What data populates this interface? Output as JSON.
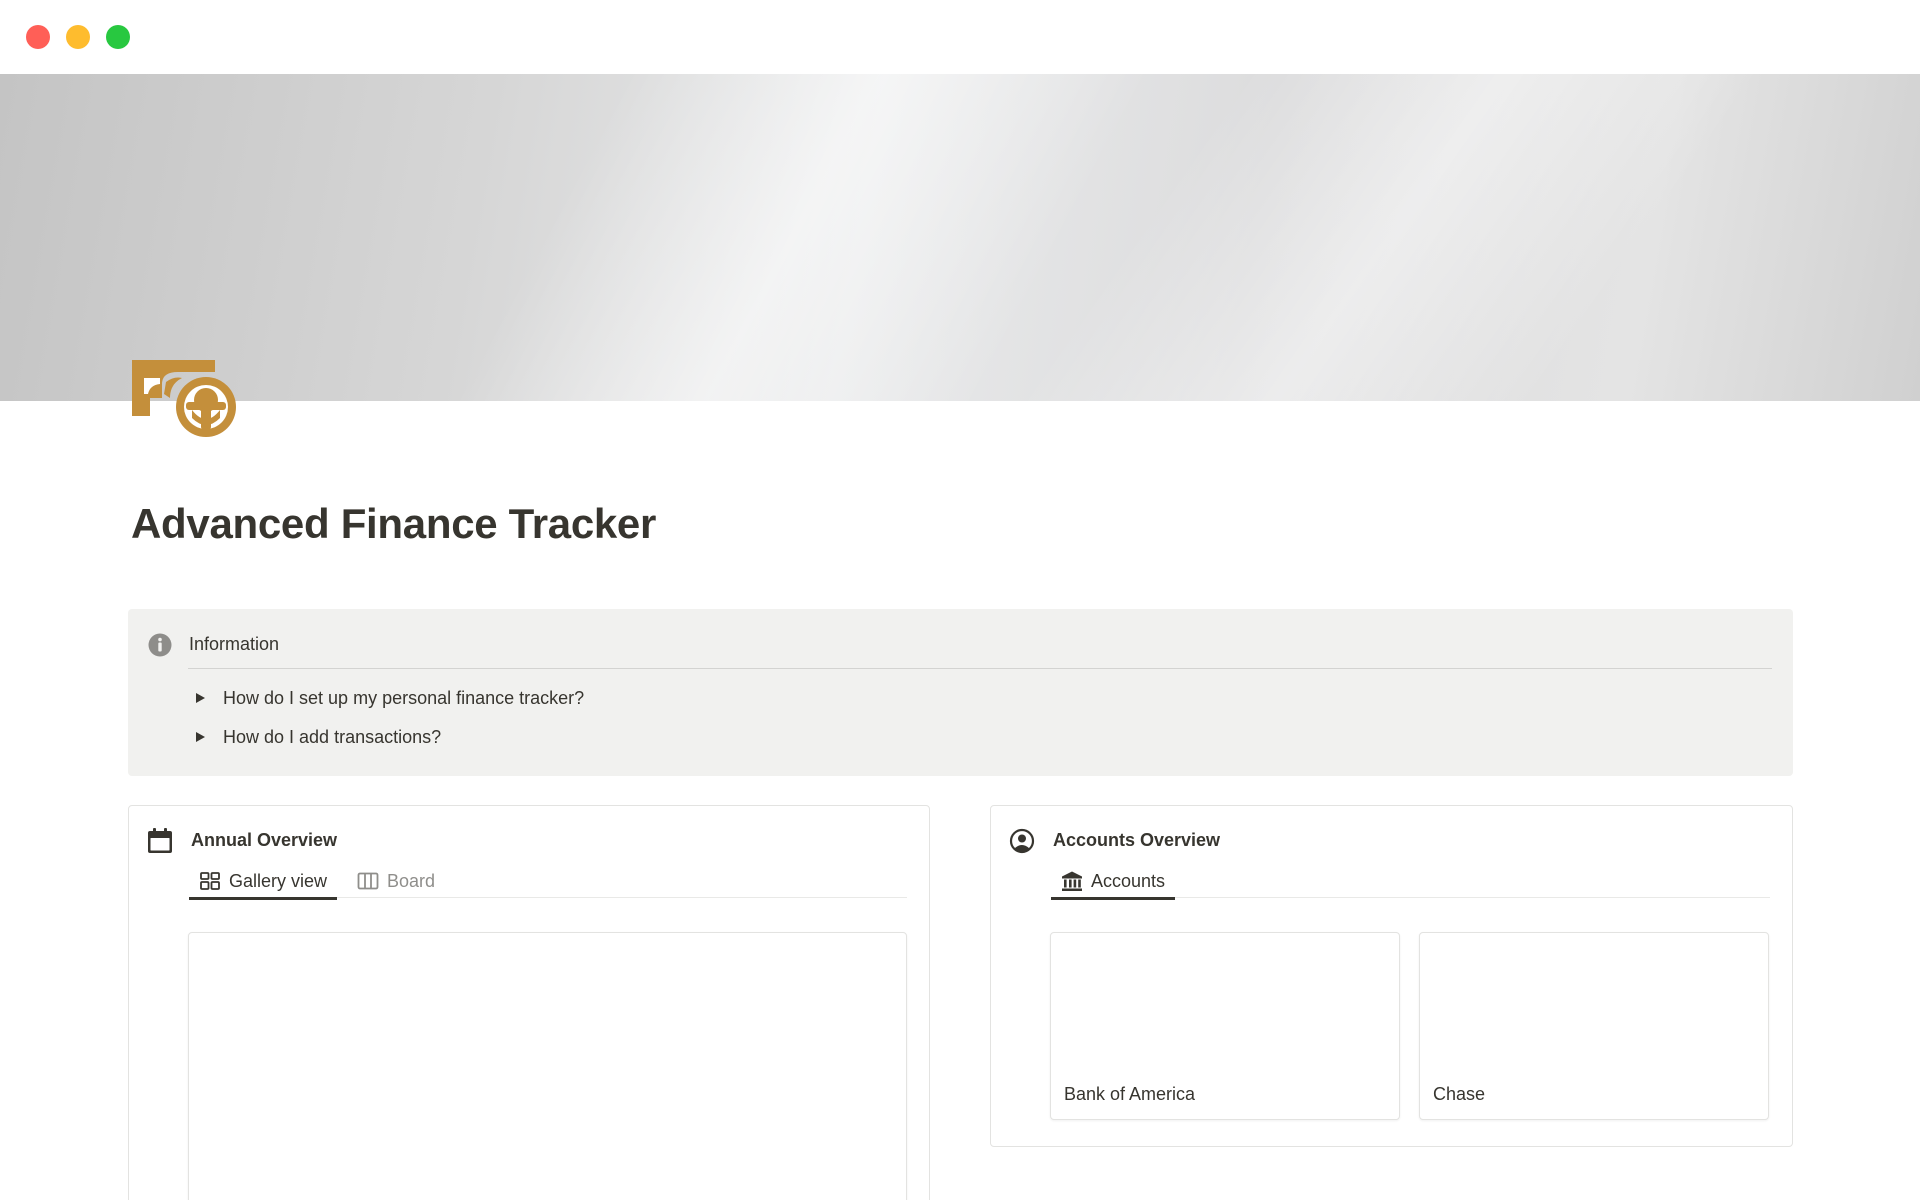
{
  "window": {
    "buttons": [
      "close",
      "minimize",
      "zoom"
    ],
    "colors": {
      "close": "#ff5f57",
      "minimize": "#febc2e",
      "zoom": "#28c840"
    }
  },
  "page": {
    "icon": "money-icon",
    "icon_color": "#c48f3b",
    "title": "Advanced Finance Tracker"
  },
  "callout": {
    "icon": "info-icon",
    "title": "Information",
    "toggles": [
      {
        "label": "How do I set up my personal finance tracker?"
      },
      {
        "label": "How do I add transactions?"
      }
    ]
  },
  "annual_overview": {
    "icon": "calendar-icon",
    "title": "Annual Overview",
    "tabs": [
      {
        "label": "Gallery view",
        "icon": "gallery-icon",
        "active": true
      },
      {
        "label": "Board",
        "icon": "board-icon",
        "active": false
      }
    ],
    "cards": [
      {
        "label": ""
      }
    ]
  },
  "accounts_overview": {
    "icon": "user-circle-icon",
    "title": "Accounts Overview",
    "tabs": [
      {
        "label": "Accounts",
        "icon": "bank-icon",
        "active": true
      }
    ],
    "cards": [
      {
        "label": "Bank of America"
      },
      {
        "label": "Chase"
      }
    ]
  }
}
